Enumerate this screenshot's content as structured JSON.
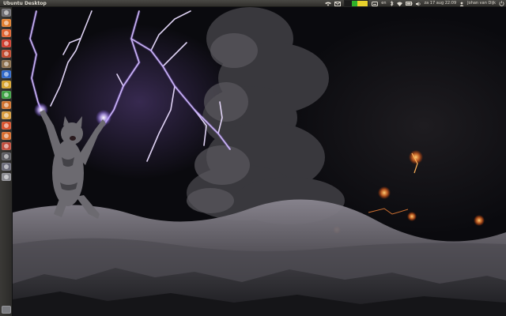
{
  "top_panel": {
    "window_title": "Ubuntu Desktop",
    "indicators": {
      "language": "en",
      "datetime": "za 17 aug 22:09",
      "user": "Johan van Dijk"
    },
    "system_monitor_colors": [
      "#1b1b1b",
      "#2fb02a",
      "#e8d12c"
    ]
  },
  "launcher": {
    "items": [
      {
        "icon": "dash-home-icon",
        "color": "#6b6a6f"
      },
      {
        "icon": "files-icon",
        "color": "#e07b2a"
      },
      {
        "icon": "firefox-icon",
        "color": "#e0602c"
      },
      {
        "icon": "browser-icon",
        "color": "#d03a2a"
      },
      {
        "icon": "app-icon",
        "color": "#c0462a"
      },
      {
        "icon": "apps-grid-icon",
        "color": "#8a6d4a"
      },
      {
        "icon": "writer-icon",
        "color": "#2a64c8"
      },
      {
        "icon": "email-icon",
        "color": "#d7a12a"
      },
      {
        "icon": "calc-icon",
        "color": "#3aa040"
      },
      {
        "icon": "impress-icon",
        "color": "#d0702a"
      },
      {
        "icon": "document-icon",
        "color": "#d89a3a"
      },
      {
        "icon": "music-icon",
        "color": "#d8502a"
      },
      {
        "icon": "software-center-icon",
        "color": "#d86a2a"
      },
      {
        "icon": "settings-icon",
        "color": "#c04a3a"
      },
      {
        "icon": "video-icon",
        "color": "#5a5a60"
      },
      {
        "icon": "terminal-icon",
        "color": "#6a6a78"
      },
      {
        "icon": "drive-icon",
        "color": "#8a8a90"
      }
    ],
    "trash_icon": "trash-icon"
  }
}
